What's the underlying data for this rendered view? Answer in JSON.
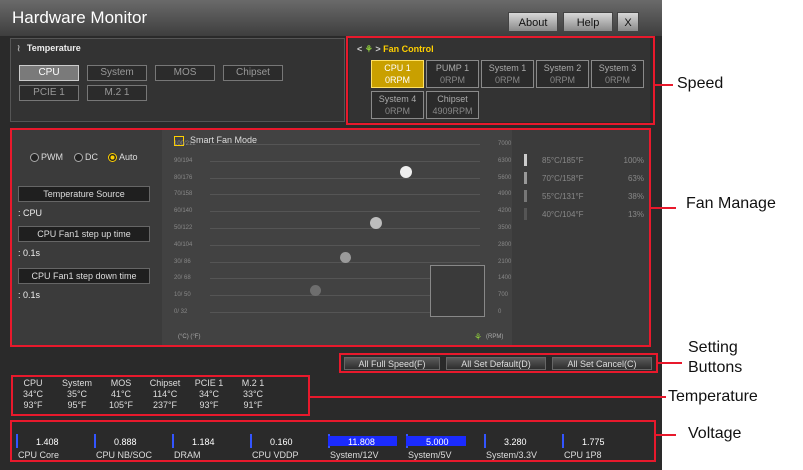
{
  "app": {
    "title": "Hardware Monitor",
    "about": "About",
    "help": "Help",
    "close": "X"
  },
  "temperature_panel": {
    "header": "Temperature",
    "tabs": [
      {
        "label": "CPU",
        "selected": true
      },
      {
        "label": "System",
        "selected": false
      },
      {
        "label": "MOS",
        "selected": false
      },
      {
        "label": "Chipset",
        "selected": false
      },
      {
        "label": "PCIE 1",
        "selected": false
      },
      {
        "label": "M.2 1",
        "selected": false
      }
    ]
  },
  "fan_control": {
    "header": "Fan Control",
    "prev_arrow": "<",
    "next_arrow": ">",
    "fans": [
      {
        "name": "CPU 1",
        "value": "0RPM",
        "selected": true
      },
      {
        "name": "PUMP 1",
        "value": "0RPM",
        "selected": false
      },
      {
        "name": "System 1",
        "value": "0RPM",
        "selected": false
      },
      {
        "name": "System 2",
        "value": "0RPM",
        "selected": false
      },
      {
        "name": "System 3",
        "value": "0RPM",
        "selected": false
      },
      {
        "name": "System 4",
        "value": "0RPM",
        "selected": false
      },
      {
        "name": "Chipset",
        "value": "4909RPM",
        "selected": false
      }
    ]
  },
  "fan_manage": {
    "modes": [
      {
        "label": "PWM",
        "selected": false
      },
      {
        "label": "DC",
        "selected": false
      },
      {
        "label": "Auto",
        "selected": true
      }
    ],
    "temperature_source_label": "Temperature Source",
    "temperature_source_value": ": CPU",
    "step_up_label": "CPU Fan1 step up time",
    "step_up_value": ": 0.1s",
    "step_down_label": "CPU Fan1 step down time",
    "step_down_value": ": 0.1s",
    "smart_fan_label": "Smart Fan Mode",
    "y_ticks_left": [
      "100/212",
      "90/194",
      "80/176",
      "70/158",
      "60/140",
      "50/122",
      "40/104",
      "30/ 86",
      "20/ 68",
      "10/ 50",
      "0/ 32"
    ],
    "y_ticks_right": [
      "7000",
      "6300",
      "5600",
      "4900",
      "4200",
      "3500",
      "2800",
      "2100",
      "1400",
      "700",
      "0"
    ],
    "x_axis_left": "(°C) (°F)",
    "x_axis_right": "(RPM)",
    "thresholds": [
      {
        "temp": "85°C/185°F",
        "pct": "100%"
      },
      {
        "temp": "70°C/158°F",
        "pct": "63%"
      },
      {
        "temp": "55°C/131°F",
        "pct": "38%"
      },
      {
        "temp": "40°C/104°F",
        "pct": "13%"
      }
    ]
  },
  "setting_buttons": {
    "full_speed": "All Full Speed(F)",
    "set_default": "All Set Default(D)",
    "set_cancel": "All Set Cancel(C)"
  },
  "temperatures": [
    {
      "name": "CPU",
      "c": "34°C",
      "f": "93°F"
    },
    {
      "name": "System",
      "c": "35°C",
      "f": "95°F"
    },
    {
      "name": "MOS",
      "c": "41°C",
      "f": "105°F"
    },
    {
      "name": "Chipset",
      "c": "114°C",
      "f": "237°F"
    },
    {
      "name": "PCIE 1",
      "c": "34°C",
      "f": "93°F"
    },
    {
      "name": "M.2 1",
      "c": "33°C",
      "f": "91°F"
    }
  ],
  "voltages": [
    {
      "name": "CPU Core",
      "value": "1.408",
      "level": 0.0
    },
    {
      "name": "CPU NB/SOC",
      "value": "0.888",
      "level": 0.0
    },
    {
      "name": "DRAM",
      "value": "1.184",
      "level": 0.0
    },
    {
      "name": "CPU VDDP",
      "value": "0.160",
      "level": 0.0
    },
    {
      "name": "System/12V",
      "value": "11.808",
      "level": 0.98
    },
    {
      "name": "System/5V",
      "value": "5.000",
      "level": 0.85
    },
    {
      "name": "System/3.3V",
      "value": "3.280",
      "level": 0.0
    },
    {
      "name": "CPU 1P8",
      "value": "1.775",
      "level": 0.0
    }
  ],
  "callouts": {
    "speed": "Speed",
    "fan_manage": "Fan Manage",
    "setting_buttons_1": "Setting",
    "setting_buttons_2": "Buttons",
    "temperature": "Temperature",
    "voltage": "Voltage"
  }
}
